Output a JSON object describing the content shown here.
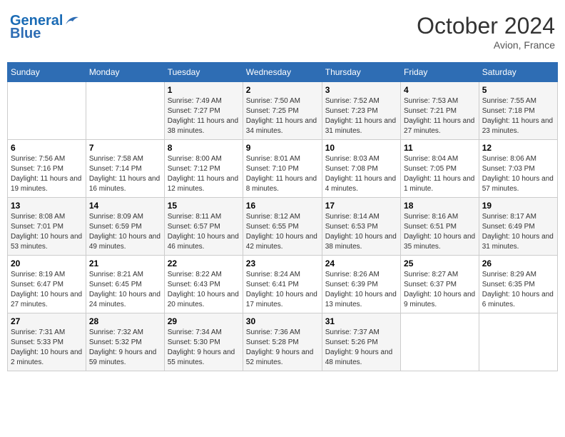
{
  "header": {
    "logo_line1": "General",
    "logo_line2": "Blue",
    "month_title": "October 2024",
    "location": "Avion, France"
  },
  "days_of_week": [
    "Sunday",
    "Monday",
    "Tuesday",
    "Wednesday",
    "Thursday",
    "Friday",
    "Saturday"
  ],
  "weeks": [
    [
      {
        "day": "",
        "info": ""
      },
      {
        "day": "",
        "info": ""
      },
      {
        "day": "1",
        "info": "Sunrise: 7:49 AM\nSunset: 7:27 PM\nDaylight: 11 hours and 38 minutes."
      },
      {
        "day": "2",
        "info": "Sunrise: 7:50 AM\nSunset: 7:25 PM\nDaylight: 11 hours and 34 minutes."
      },
      {
        "day": "3",
        "info": "Sunrise: 7:52 AM\nSunset: 7:23 PM\nDaylight: 11 hours and 31 minutes."
      },
      {
        "day": "4",
        "info": "Sunrise: 7:53 AM\nSunset: 7:21 PM\nDaylight: 11 hours and 27 minutes."
      },
      {
        "day": "5",
        "info": "Sunrise: 7:55 AM\nSunset: 7:18 PM\nDaylight: 11 hours and 23 minutes."
      }
    ],
    [
      {
        "day": "6",
        "info": "Sunrise: 7:56 AM\nSunset: 7:16 PM\nDaylight: 11 hours and 19 minutes."
      },
      {
        "day": "7",
        "info": "Sunrise: 7:58 AM\nSunset: 7:14 PM\nDaylight: 11 hours and 16 minutes."
      },
      {
        "day": "8",
        "info": "Sunrise: 8:00 AM\nSunset: 7:12 PM\nDaylight: 11 hours and 12 minutes."
      },
      {
        "day": "9",
        "info": "Sunrise: 8:01 AM\nSunset: 7:10 PM\nDaylight: 11 hours and 8 minutes."
      },
      {
        "day": "10",
        "info": "Sunrise: 8:03 AM\nSunset: 7:08 PM\nDaylight: 11 hours and 4 minutes."
      },
      {
        "day": "11",
        "info": "Sunrise: 8:04 AM\nSunset: 7:05 PM\nDaylight: 11 hours and 1 minute."
      },
      {
        "day": "12",
        "info": "Sunrise: 8:06 AM\nSunset: 7:03 PM\nDaylight: 10 hours and 57 minutes."
      }
    ],
    [
      {
        "day": "13",
        "info": "Sunrise: 8:08 AM\nSunset: 7:01 PM\nDaylight: 10 hours and 53 minutes."
      },
      {
        "day": "14",
        "info": "Sunrise: 8:09 AM\nSunset: 6:59 PM\nDaylight: 10 hours and 49 minutes."
      },
      {
        "day": "15",
        "info": "Sunrise: 8:11 AM\nSunset: 6:57 PM\nDaylight: 10 hours and 46 minutes."
      },
      {
        "day": "16",
        "info": "Sunrise: 8:12 AM\nSunset: 6:55 PM\nDaylight: 10 hours and 42 minutes."
      },
      {
        "day": "17",
        "info": "Sunrise: 8:14 AM\nSunset: 6:53 PM\nDaylight: 10 hours and 38 minutes."
      },
      {
        "day": "18",
        "info": "Sunrise: 8:16 AM\nSunset: 6:51 PM\nDaylight: 10 hours and 35 minutes."
      },
      {
        "day": "19",
        "info": "Sunrise: 8:17 AM\nSunset: 6:49 PM\nDaylight: 10 hours and 31 minutes."
      }
    ],
    [
      {
        "day": "20",
        "info": "Sunrise: 8:19 AM\nSunset: 6:47 PM\nDaylight: 10 hours and 27 minutes."
      },
      {
        "day": "21",
        "info": "Sunrise: 8:21 AM\nSunset: 6:45 PM\nDaylight: 10 hours and 24 minutes."
      },
      {
        "day": "22",
        "info": "Sunrise: 8:22 AM\nSunset: 6:43 PM\nDaylight: 10 hours and 20 minutes."
      },
      {
        "day": "23",
        "info": "Sunrise: 8:24 AM\nSunset: 6:41 PM\nDaylight: 10 hours and 17 minutes."
      },
      {
        "day": "24",
        "info": "Sunrise: 8:26 AM\nSunset: 6:39 PM\nDaylight: 10 hours and 13 minutes."
      },
      {
        "day": "25",
        "info": "Sunrise: 8:27 AM\nSunset: 6:37 PM\nDaylight: 10 hours and 9 minutes."
      },
      {
        "day": "26",
        "info": "Sunrise: 8:29 AM\nSunset: 6:35 PM\nDaylight: 10 hours and 6 minutes."
      }
    ],
    [
      {
        "day": "27",
        "info": "Sunrise: 7:31 AM\nSunset: 5:33 PM\nDaylight: 10 hours and 2 minutes."
      },
      {
        "day": "28",
        "info": "Sunrise: 7:32 AM\nSunset: 5:32 PM\nDaylight: 9 hours and 59 minutes."
      },
      {
        "day": "29",
        "info": "Sunrise: 7:34 AM\nSunset: 5:30 PM\nDaylight: 9 hours and 55 minutes."
      },
      {
        "day": "30",
        "info": "Sunrise: 7:36 AM\nSunset: 5:28 PM\nDaylight: 9 hours and 52 minutes."
      },
      {
        "day": "31",
        "info": "Sunrise: 7:37 AM\nSunset: 5:26 PM\nDaylight: 9 hours and 48 minutes."
      },
      {
        "day": "",
        "info": ""
      },
      {
        "day": "",
        "info": ""
      }
    ]
  ]
}
